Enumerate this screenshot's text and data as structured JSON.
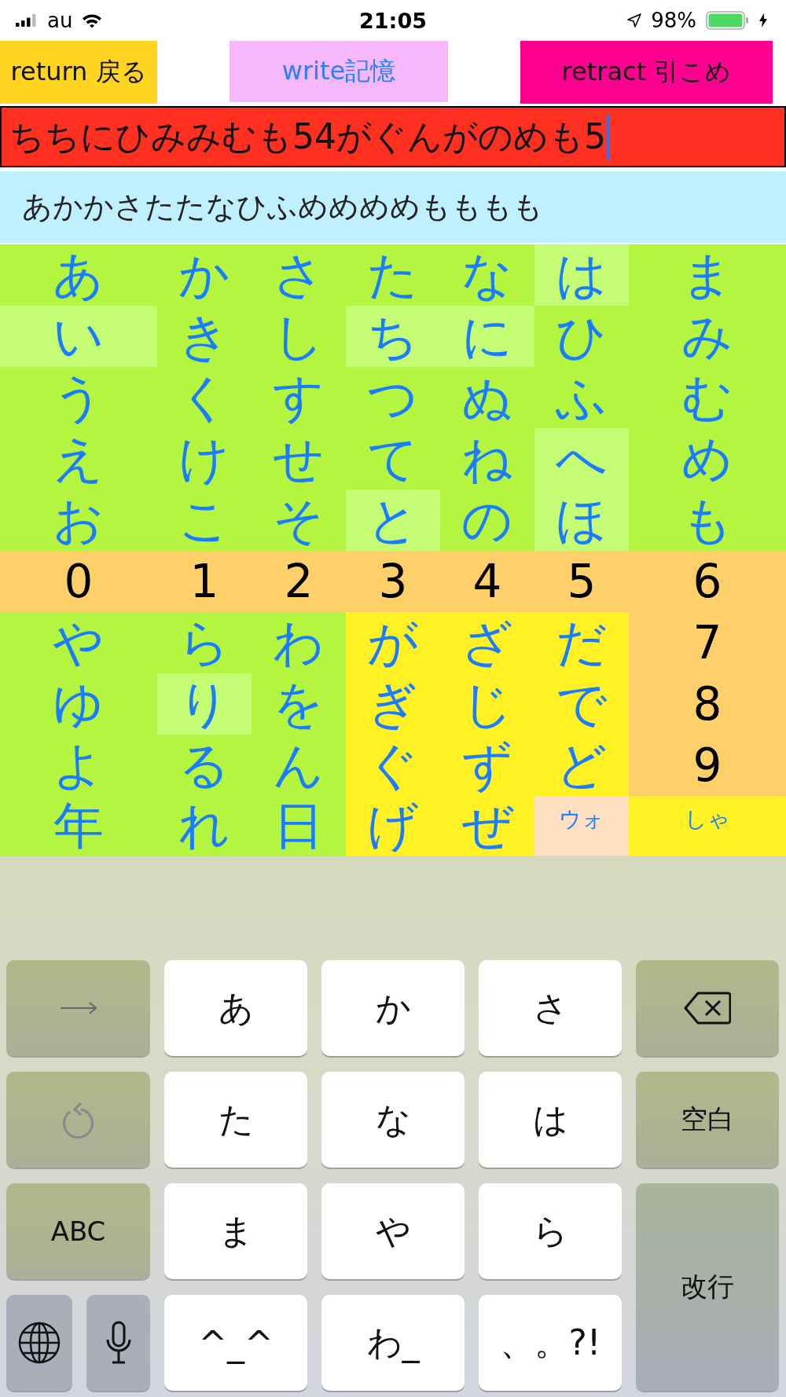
{
  "status_bar": {
    "carrier": "au",
    "time": "21:05",
    "battery": "98%"
  },
  "buttons": [
    {
      "label": "return 戻る",
      "kind": "return"
    },
    {
      "label": "write記憶",
      "kind": "write"
    },
    {
      "label": "retract  引こめ",
      "kind": "retract"
    }
  ],
  "input": {
    "value": "ちちにひみみむも54がぐんがのめも5"
  },
  "suggestion": "あかかさたたなひふめめめめもももも",
  "grid": [
    {
      "cells": [
        {
          "text": "あ",
          "kind": "kana",
          "color": "#b3f53f"
        },
        {
          "text": "か",
          "kind": "kana",
          "color": "#b3f53f"
        },
        {
          "text": "さ",
          "kind": "kana",
          "color": "#b3f53f"
        },
        {
          "text": "た",
          "kind": "kana",
          "color": "#b3f53f"
        },
        {
          "text": "な",
          "kind": "kana",
          "color": "#b3f53f"
        },
        {
          "text": "は",
          "kind": "kana",
          "color": "#c4fc74"
        },
        {
          "text": "ま",
          "kind": "kana",
          "color": "#b3f53f"
        }
      ]
    },
    {
      "cells": [
        {
          "text": "い",
          "kind": "kana",
          "color": "#c4fc74"
        },
        {
          "text": "き",
          "kind": "kana",
          "color": "#b3f53f"
        },
        {
          "text": "し",
          "kind": "kana",
          "color": "#b3f53f"
        },
        {
          "text": "ち",
          "kind": "kana",
          "color": "#c4fc74"
        },
        {
          "text": "に",
          "kind": "kana",
          "color": "#c4fc74"
        },
        {
          "text": "ひ",
          "kind": "kana",
          "color": "#b3f53f"
        },
        {
          "text": "み",
          "kind": "kana",
          "color": "#b3f53f"
        }
      ]
    },
    {
      "cells": [
        {
          "text": "う",
          "kind": "kana",
          "color": "#b3f53f"
        },
        {
          "text": "く",
          "kind": "kana",
          "color": "#b3f53f"
        },
        {
          "text": "す",
          "kind": "kana",
          "color": "#b3f53f"
        },
        {
          "text": "つ",
          "kind": "kana",
          "color": "#b3f53f"
        },
        {
          "text": "ぬ",
          "kind": "kana",
          "color": "#b3f53f"
        },
        {
          "text": "ふ",
          "kind": "kana",
          "color": "#b3f53f"
        },
        {
          "text": "む",
          "kind": "kana",
          "color": "#b3f53f"
        }
      ]
    },
    {
      "cells": [
        {
          "text": "え",
          "kind": "kana",
          "color": "#b3f53f"
        },
        {
          "text": "け",
          "kind": "kana",
          "color": "#b3f53f"
        },
        {
          "text": "せ",
          "kind": "kana",
          "color": "#b3f53f"
        },
        {
          "text": "て",
          "kind": "kana",
          "color": "#b3f53f"
        },
        {
          "text": "ね",
          "kind": "kana",
          "color": "#b3f53f"
        },
        {
          "text": "へ",
          "kind": "kana",
          "color": "#c4fc74"
        },
        {
          "text": "め",
          "kind": "kana",
          "color": "#b3f53f"
        }
      ]
    },
    {
      "cells": [
        {
          "text": "お",
          "kind": "kana",
          "color": "#b3f53f"
        },
        {
          "text": "こ",
          "kind": "kana",
          "color": "#b3f53f"
        },
        {
          "text": "そ",
          "kind": "kana",
          "color": "#b3f53f"
        },
        {
          "text": "と",
          "kind": "kana",
          "color": "#c4fc74"
        },
        {
          "text": "の",
          "kind": "kana",
          "color": "#b3f53f"
        },
        {
          "text": "ほ",
          "kind": "kana",
          "color": "#c4fc74"
        },
        {
          "text": "も",
          "kind": "kana",
          "color": "#b3f53f"
        }
      ]
    },
    {
      "cells": [
        {
          "text": "0",
          "kind": "digit",
          "color": "#ffd06a"
        },
        {
          "text": "1",
          "kind": "digit",
          "color": "#ffd06a"
        },
        {
          "text": "2",
          "kind": "digit",
          "color": "#ffd06a"
        },
        {
          "text": "3",
          "kind": "digit",
          "color": "#ffd06a"
        },
        {
          "text": "4",
          "kind": "digit",
          "color": "#ffd06a"
        },
        {
          "text": "5",
          "kind": "digit",
          "color": "#ffd06a"
        },
        {
          "text": "6",
          "kind": "digit",
          "color": "#ffd06a"
        }
      ]
    },
    {
      "cells": [
        {
          "text": "や",
          "kind": "kana",
          "color": "#b3f53f"
        },
        {
          "text": "ら",
          "kind": "kana",
          "color": "#b3f53f"
        },
        {
          "text": "わ",
          "kind": "kana",
          "color": "#b3f53f"
        },
        {
          "text": "が",
          "kind": "kana",
          "color": "#fff123"
        },
        {
          "text": "ざ",
          "kind": "kana",
          "color": "#fff123"
        },
        {
          "text": "だ",
          "kind": "kana",
          "color": "#fff123"
        },
        {
          "text": "7",
          "kind": "digit",
          "color": "#ffd06a"
        }
      ]
    },
    {
      "cells": [
        {
          "text": "ゆ",
          "kind": "kana",
          "color": "#b3f53f"
        },
        {
          "text": "り",
          "kind": "kana",
          "color": "#c4fc74"
        },
        {
          "text": "を",
          "kind": "kana",
          "color": "#b3f53f"
        },
        {
          "text": "ぎ",
          "kind": "kana",
          "color": "#fff123"
        },
        {
          "text": "じ",
          "kind": "kana",
          "color": "#fff123"
        },
        {
          "text": "で",
          "kind": "kana",
          "color": "#fff123"
        },
        {
          "text": "8",
          "kind": "digit",
          "color": "#ffd06a"
        }
      ]
    },
    {
      "cells": [
        {
          "text": "よ",
          "kind": "kana",
          "color": "#b3f53f"
        },
        {
          "text": "る",
          "kind": "kana",
          "color": "#b3f53f"
        },
        {
          "text": "ん",
          "kind": "kana",
          "color": "#b3f53f"
        },
        {
          "text": "ぐ",
          "kind": "kana",
          "color": "#fff123"
        },
        {
          "text": "ず",
          "kind": "kana",
          "color": "#fff123"
        },
        {
          "text": "ど",
          "kind": "kana",
          "color": "#fff123"
        },
        {
          "text": "9",
          "kind": "digit",
          "color": "#ffd06a"
        }
      ]
    },
    {
      "cells": [
        {
          "text": "年",
          "kind": "kana",
          "color": "#b3f53f"
        },
        {
          "text": "れ",
          "kind": "kana",
          "color": "#b3f53f"
        },
        {
          "text": "日",
          "kind": "kana",
          "color": "#b3f53f"
        },
        {
          "text": "げ",
          "kind": "kana",
          "color": "#fff123"
        },
        {
          "text": "ぜ",
          "kind": "kana",
          "color": "#fff123"
        },
        {
          "text": "ウォ",
          "kind": "small",
          "color": "#ffe0c2"
        },
        {
          "text": "しゃ",
          "kind": "small",
          "color": "#fff123"
        }
      ]
    }
  ],
  "keyboard": [
    [
      {
        "kind": "arrow"
      },
      {
        "kind": "char",
        "label": "あ"
      },
      {
        "kind": "char",
        "label": "か"
      },
      {
        "kind": "char",
        "label": "さ"
      },
      {
        "kind": "delete"
      }
    ],
    [
      {
        "kind": "undo"
      },
      {
        "kind": "char",
        "label": "た"
      },
      {
        "kind": "char",
        "label": "な"
      },
      {
        "kind": "char",
        "label": "は"
      },
      {
        "kind": "function",
        "label": "空白"
      }
    ],
    [
      {
        "kind": "function",
        "label": "ABC"
      },
      {
        "kind": "char",
        "label": "ま"
      },
      {
        "kind": "char",
        "label": "や"
      },
      {
        "kind": "char",
        "label": "ら"
      },
      {
        "kind": "enter",
        "label": "改行"
      }
    ],
    [
      {
        "kind": "globe"
      },
      {
        "kind": "mic"
      },
      {
        "kind": "char",
        "label": "^_^"
      },
      {
        "kind": "char",
        "label": "わ_"
      },
      {
        "kind": "char",
        "label": "、。?!"
      }
    ]
  ]
}
